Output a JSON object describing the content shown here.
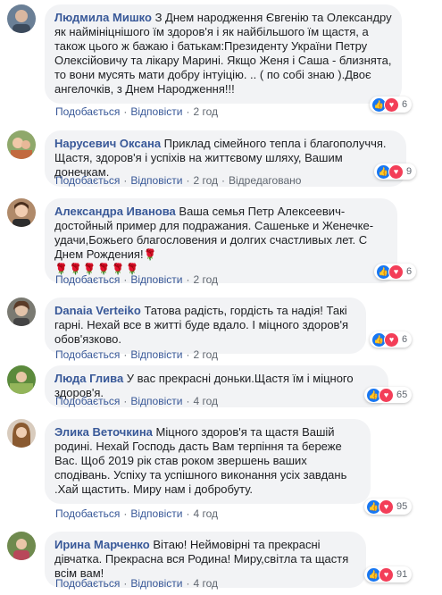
{
  "action_labels": {
    "like": "Подобається",
    "reply": "Відповісти",
    "edited": "Відредаговано"
  },
  "comments": [
    {
      "author": "Людмила Мишко",
      "text": "З Днем народження Євгенію та Олександру як наймініцнішого їм здоров'я і як найбільшого їм щастя, а також цього ж бажаю і батькам:Президенту України Петру Олексійовичу та лікару Марині. Якщо Женя і Саша - близнята, то вони мусять мати добру інтуіцію. .. ( по собі знаю ).Двоє ангелочків, з Днем Народження!!!",
      "time": "2 год",
      "reactions": 6
    },
    {
      "author": "Нарусевич Оксана",
      "text": "Приклад сімейного тепла і благополуччя. Щастя, здоров'я і успіхів на життєвому шляху, Вашим донечкам.",
      "time": "2 год",
      "edited": true,
      "reactions": 9
    },
    {
      "author": "Александра Иванова",
      "text": "Ваша семья Петр Алексеевич-достойный пример для подражания. Сашенькe и Женечке- удачи,Божьего благословения и долгих счастливых лет. С Днем Рождения!",
      "time": "2 год",
      "reactions": 6
    },
    {
      "author": "Danaia Verteiko",
      "text": "Татова радість, гордість та надія! Такі гарні. Нехай все в житті буде вдало. І міцного здоров'я обов'язково.",
      "time": "2 год",
      "reactions": 6
    },
    {
      "author": "Люда Глива",
      "text": "У вас прекрасні доньки.Щастя їм і міцного здоров'я.",
      "time": "4 год",
      "reactions": 65
    },
    {
      "author": "Элика Веточкина",
      "text": "Міцного здоров'я та щастя Вашій родині. Нехай Господь дасть Вам терпіння та береже Вас. Щоб 2019 рік став роком звершень ваших сподівань. Успіху та успішного виконання усіх завдань .Хай щастить. Миру нам і добробуту.",
      "time": "4 год",
      "reactions": 95
    },
    {
      "author": "Ирина Марченко",
      "text": "Вітаю! Неймовірні та прекрасні дівчатка. Прекрасна вся Родина! Миру,світла та щастя всім вам!",
      "time": "4 год",
      "reactions": 91
    }
  ]
}
